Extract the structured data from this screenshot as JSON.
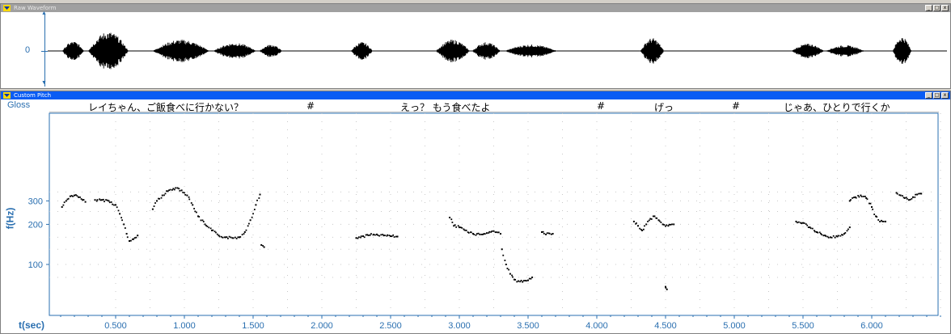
{
  "waveform_window": {
    "title": "Raw Waveform",
    "y_tick": "0",
    "buttons": [
      "_",
      "□",
      "x"
    ]
  },
  "pitch_window": {
    "title": "Custom Pitch",
    "gloss_label": "Gloss",
    "gloss_items": [
      "レイちゃん、ご飯食べに行かない？",
      "#",
      "えっ？ もう食べたよ",
      "#",
      "げっ",
      "#",
      "じゃあ、ひとりで行くか"
    ],
    "y_axis_label": "f(Hz)",
    "y_ticks": [
      "300",
      "200",
      "100"
    ],
    "x_axis_label": "t(sec)",
    "x_ticks": [
      "0.500",
      "1.000",
      "1.500",
      "2.000",
      "2.500",
      "3.000",
      "3.500",
      "4.000",
      "4.500",
      "5.000",
      "5.500",
      "6.000"
    ],
    "buttons": [
      "_",
      "□",
      "x"
    ]
  },
  "colors": {
    "active_title": "#0a5cf4",
    "inactive_title": "#a0a0a0",
    "axis": "#2a6fb0",
    "trace": "#000000"
  },
  "chart_data": {
    "type": "scatter",
    "ylabel": "f(Hz)",
    "xlabel": "t(sec)",
    "xlim": [
      0.0,
      6.6
    ],
    "ylim": [
      60,
      400
    ],
    "y_scale": "log",
    "grid": true,
    "segments": [
      {
        "t": [
          0.11,
          0.14,
          0.17,
          0.2,
          0.23,
          0.26,
          0.28
        ],
        "f": [
          270,
          300,
          325,
          330,
          320,
          305,
          295
        ]
      },
      {
        "t": [
          0.35,
          0.4,
          0.45,
          0.5,
          0.53,
          0.56,
          0.58,
          0.6,
          0.63,
          0.66
        ],
        "f": [
          305,
          305,
          300,
          280,
          240,
          200,
          170,
          150,
          155,
          165
        ]
      },
      {
        "t": [
          0.77,
          0.8,
          0.84,
          0.88,
          0.92,
          0.95,
          0.98,
          1.02,
          1.06,
          1.1,
          1.15,
          1.2,
          1.25,
          1.3,
          1.35,
          1.4,
          1.44,
          1.48,
          1.52,
          1.55
        ],
        "f": [
          260,
          300,
          330,
          355,
          370,
          375,
          360,
          330,
          280,
          230,
          200,
          180,
          165,
          160,
          158,
          160,
          175,
          215,
          280,
          335
        ]
      },
      {
        "t": [
          1.56,
          1.58
        ],
        "f": [
          140,
          135
        ]
      },
      {
        "t": [
          2.25,
          2.3,
          2.35,
          2.4,
          2.45,
          2.5,
          2.55
        ],
        "f": [
          158,
          163,
          166,
          168,
          165,
          163,
          162
        ]
      },
      {
        "t": [
          2.93,
          2.96,
          3.0,
          3.05,
          3.1,
          3.15,
          3.2,
          3.25,
          3.3
        ],
        "f": [
          225,
          195,
          190,
          180,
          170,
          168,
          172,
          178,
          170
        ]
      },
      {
        "t": [
          3.31,
          3.34,
          3.37,
          3.4,
          3.43,
          3.46,
          3.5,
          3.53
        ],
        "f": [
          130,
          100,
          85,
          77,
          75,
          74,
          76,
          80
        ]
      },
      {
        "t": [
          3.6,
          3.63,
          3.68
        ],
        "f": [
          175,
          168,
          170
        ]
      },
      {
        "t": [
          4.27,
          4.3,
          4.33,
          4.36,
          4.39,
          4.42,
          4.45,
          4.48,
          4.52,
          4.56
        ],
        "f": [
          210,
          195,
          180,
          200,
          220,
          230,
          215,
          200,
          195,
          200
        ]
      },
      {
        "t": [
          4.5,
          4.51
        ],
        "f": [
          68,
          65
        ]
      },
      {
        "t": [
          5.45,
          5.5,
          5.55,
          5.6,
          5.65,
          5.7,
          5.75,
          5.8,
          5.84
        ],
        "f": [
          210,
          205,
          190,
          175,
          165,
          160,
          162,
          170,
          190
        ]
      },
      {
        "t": [
          5.84,
          5.88,
          5.92,
          5.96,
          6.0,
          6.03,
          6.06,
          6.1
        ],
        "f": [
          300,
          320,
          330,
          315,
          270,
          230,
          210,
          210
        ]
      },
      {
        "t": [
          6.18,
          6.21,
          6.24,
          6.27,
          6.3,
          6.33,
          6.36
        ],
        "f": [
          345,
          330,
          315,
          305,
          320,
          335,
          340
        ]
      }
    ]
  }
}
